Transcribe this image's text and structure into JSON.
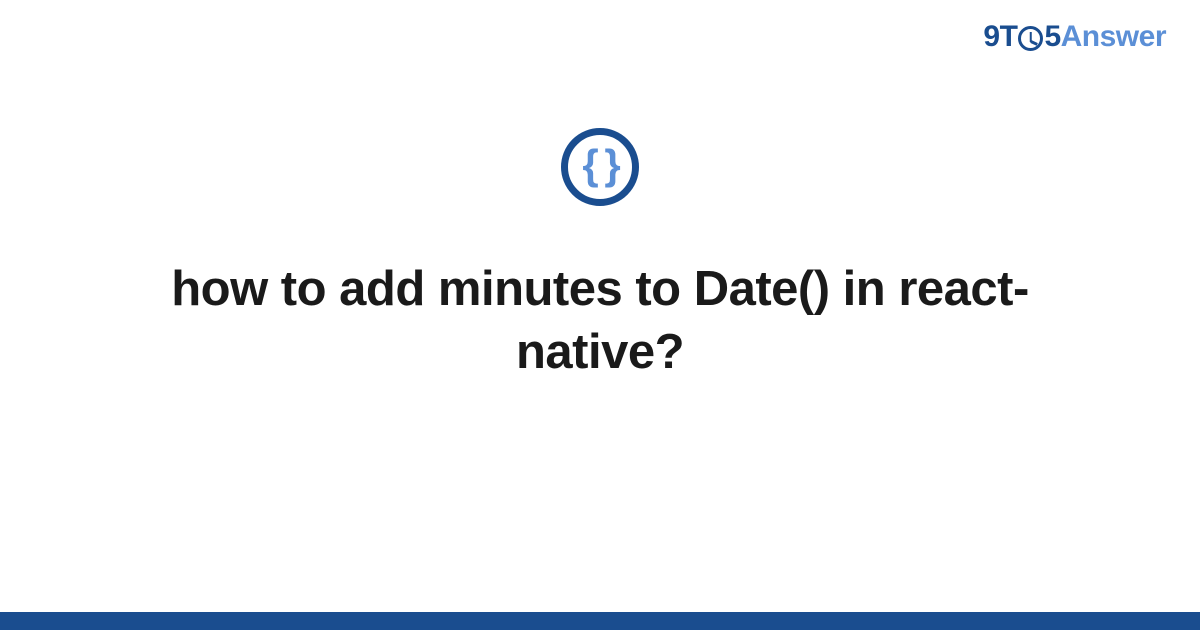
{
  "logo": {
    "part_9t": "9T",
    "part_5": "5",
    "part_answer": "Answer"
  },
  "badge": {
    "braces": "{ }"
  },
  "title": "how to add minutes to Date() in react-native?",
  "colors": {
    "brand_dark": "#1a4d8f",
    "brand_light": "#5b8fd6"
  }
}
